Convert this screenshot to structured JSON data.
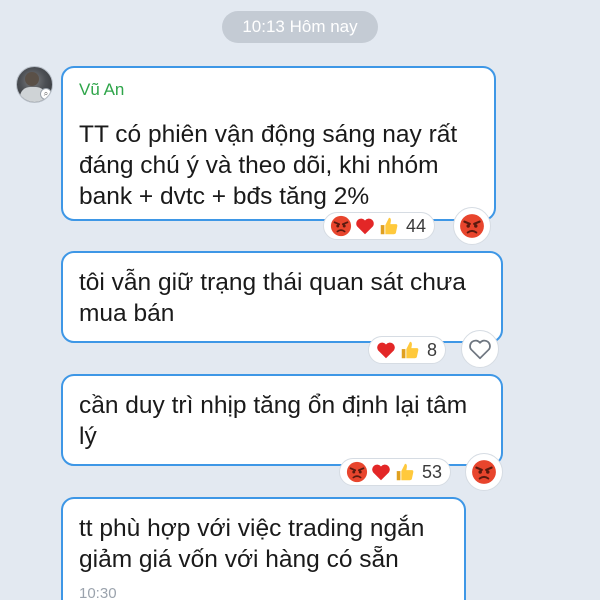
{
  "date_separator": "10:13 Hôm nay",
  "colors": {
    "background": "#e3e9f1",
    "bubble_border": "#3e97e6",
    "sender_name": "#2fa54a",
    "timestamp": "#9ba3ad"
  },
  "messages": [
    {
      "sender": "Vũ An",
      "text": "TT có phiên vận động sáng nay rất\nđáng chú ý và theo dõi, khi nhóm\nbank + dvtc + bđs tăng 2%",
      "reactions": [
        "angry-face-icon",
        "red-heart-icon",
        "thumbs-up-icon"
      ],
      "reaction_count": "44",
      "my_reaction": "angry-face-icon"
    },
    {
      "text": "tôi vẫn giữ trạng thái quan sát chưa\nmua bán",
      "reactions": [
        "red-heart-icon",
        "thumbs-up-icon"
      ],
      "reaction_count": "8",
      "my_reaction": "heart-outline-icon"
    },
    {
      "text": "cần duy trì nhịp tăng ổn định lại tâm\nlý",
      "reactions": [
        "angry-face-icon",
        "red-heart-icon",
        "thumbs-up-icon"
      ],
      "reaction_count": "53",
      "my_reaction": "angry-face-icon"
    },
    {
      "text": "tt phù hợp với việc trading ngắn\ngiảm giá vốn với hàng có sẵn",
      "time": "10:30"
    }
  ]
}
